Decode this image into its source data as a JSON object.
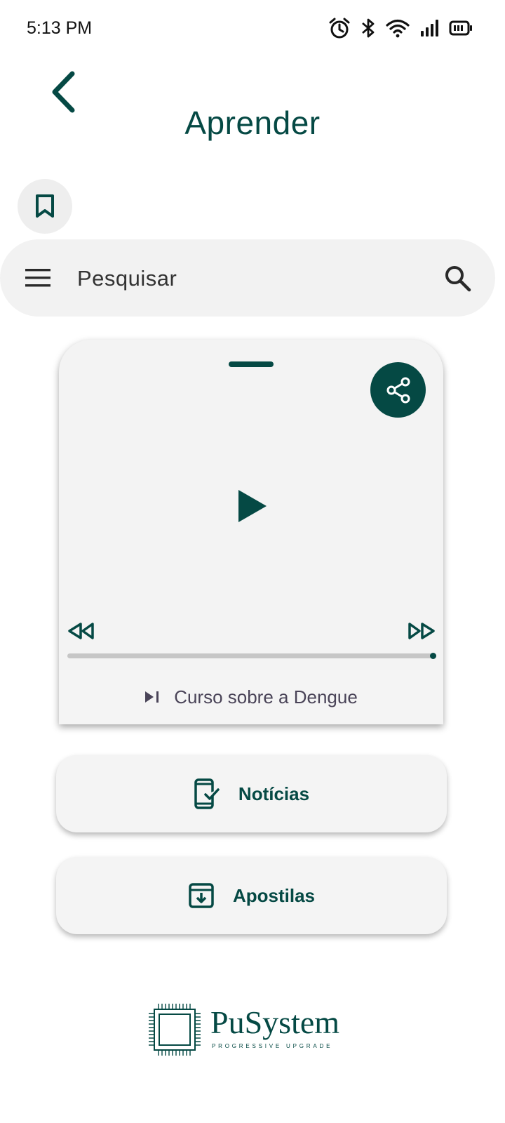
{
  "status_bar": {
    "time": "5:13 PM",
    "icons": [
      "alarm-icon",
      "bluetooth-icon",
      "wifi-icon",
      "signal-icon",
      "battery-icon"
    ]
  },
  "header": {
    "title": "Aprender"
  },
  "search": {
    "placeholder": "Pesquisar"
  },
  "player": {
    "track_title": "Curso sobre a Dengue",
    "progress": 1.0
  },
  "buttons": {
    "noticias": "Notícias",
    "apostilas": "Apostilas"
  },
  "logo": {
    "name": "PuSystem",
    "tagline": "PROGRESSIVE UPGRADE"
  },
  "colors": {
    "accent": "#054944",
    "surface": "#f3f3f3",
    "track": "#c6c6c6"
  }
}
